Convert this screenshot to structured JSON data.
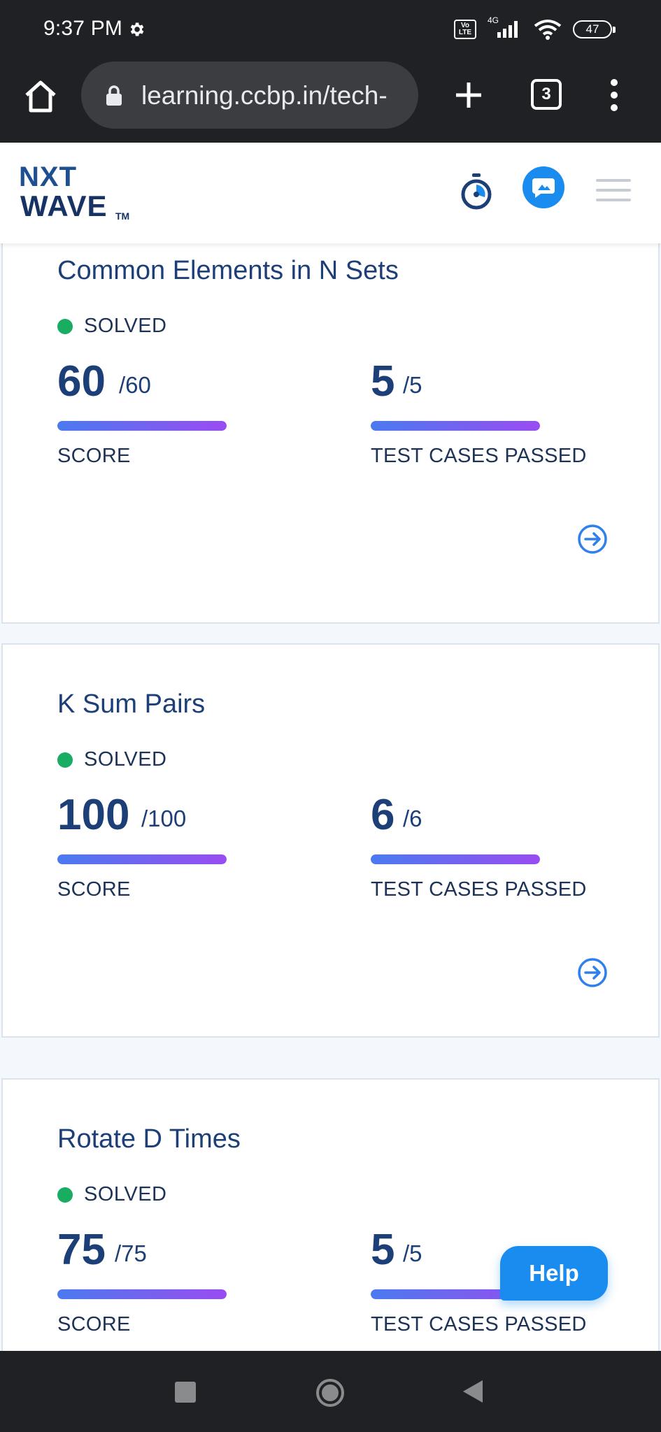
{
  "status_bar": {
    "time": "9:37 PM",
    "network_label": "4G",
    "volte_label": "Vo LTE",
    "battery_level": "47",
    "icons": [
      "gear-icon",
      "volte-icon",
      "signal-icon",
      "wifi-icon",
      "battery-icon"
    ]
  },
  "browser": {
    "url": "learning.ccbp.in/tech-",
    "tab_count": "3",
    "icons": [
      "home-icon",
      "lock-icon",
      "plus-icon",
      "more-vert-icon"
    ]
  },
  "site_header": {
    "logo_top": "NXT",
    "logo_bottom": "WAVE",
    "logo_tm": "TM",
    "icons": [
      "stopwatch-icon",
      "chat-icon",
      "hamburger-icon"
    ]
  },
  "problems": [
    {
      "title": "Common Elements in N Sets",
      "status": "SOLVED",
      "score": "60",
      "score_max": "/60",
      "score_label": "SCORE",
      "score_fraction": 1.0,
      "tests": "5",
      "tests_max": "/5",
      "tests_label": "TEST CASES PASSED",
      "tests_fraction": 1.0
    },
    {
      "title": "K Sum Pairs",
      "status": "SOLVED",
      "score": "100",
      "score_max": "/100",
      "score_label": "SCORE",
      "score_fraction": 1.0,
      "tests": "6",
      "tests_max": "/6",
      "tests_label": "TEST CASES PASSED",
      "tests_fraction": 1.0
    },
    {
      "title": "Rotate D Times",
      "status": "SOLVED",
      "score": "75",
      "score_max": "/75",
      "score_label": "SCORE",
      "score_fraction": 1.0,
      "tests": "5",
      "tests_max": "/5",
      "tests_label": "TEST CASES PASSED",
      "tests_fraction": 1.0
    }
  ],
  "help_button": {
    "label": "Help"
  },
  "colors": {
    "status_green": "#19ad63",
    "brand_blue": "#1a8cf0",
    "heading_navy": "#1d3f77",
    "bar_gradient_start": "#4a7af0",
    "bar_gradient_end": "#9a4cf0"
  }
}
